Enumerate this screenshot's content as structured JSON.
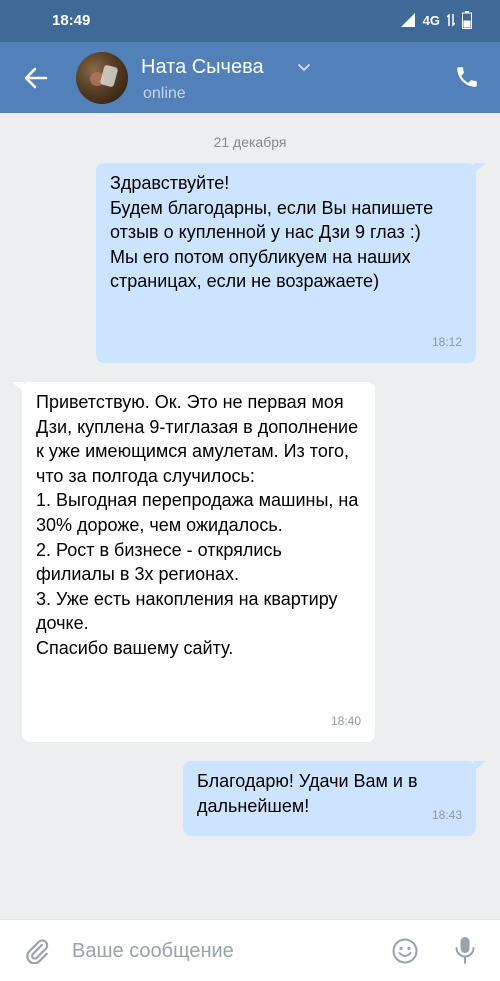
{
  "status_bar": {
    "time": "18:49",
    "network": "4G",
    "battery_level": 0.5
  },
  "header": {
    "contact_name": "Ната Сычева",
    "contact_status": "online"
  },
  "date_separator": "21 декабря",
  "messages": [
    {
      "direction": "outgoing",
      "text": "Здравствуйте!\nБудем благодарны, если Вы напишете отзыв о купленной у нас Дзи 9 глаз :)\nМы его потом опубликуем на наших страницах, если не возражаете)",
      "time": "18:12"
    },
    {
      "direction": "incoming",
      "text": "Приветствую. Ок. Это не первая моя Дзи, куплена 9-тиглазая в дополнение к уже имеющимся амулетам. Из того, что за полгода случилось:\n1. Выгодная перепродажа машины, на 30% дороже, чем ожидалось.\n2. Рост в бизнесе - открялись филиалы в 3х регионах.\n3. Уже есть накопления на квартиру дочке.\nСпасибо вашему сайту.",
      "time": "18:40"
    },
    {
      "direction": "outgoing",
      "text": "Благодарю! Удачи Вам и в дальнейшем!",
      "time": "18:43"
    }
  ],
  "composer": {
    "placeholder": "Ваше сообщение",
    "value": ""
  },
  "icons": {
    "back": "arrow-left-icon",
    "dropdown": "chevron-down-icon",
    "call": "phone-icon",
    "attach": "paperclip-icon",
    "emoji": "smile-icon",
    "voice": "microphone-icon"
  },
  "colors": {
    "status_bar": "#3f6996",
    "header": "#5181b8",
    "chat_background": "#edeef0",
    "outgoing_bubble": "#cce4ff",
    "incoming_bubble": "#ffffff"
  }
}
